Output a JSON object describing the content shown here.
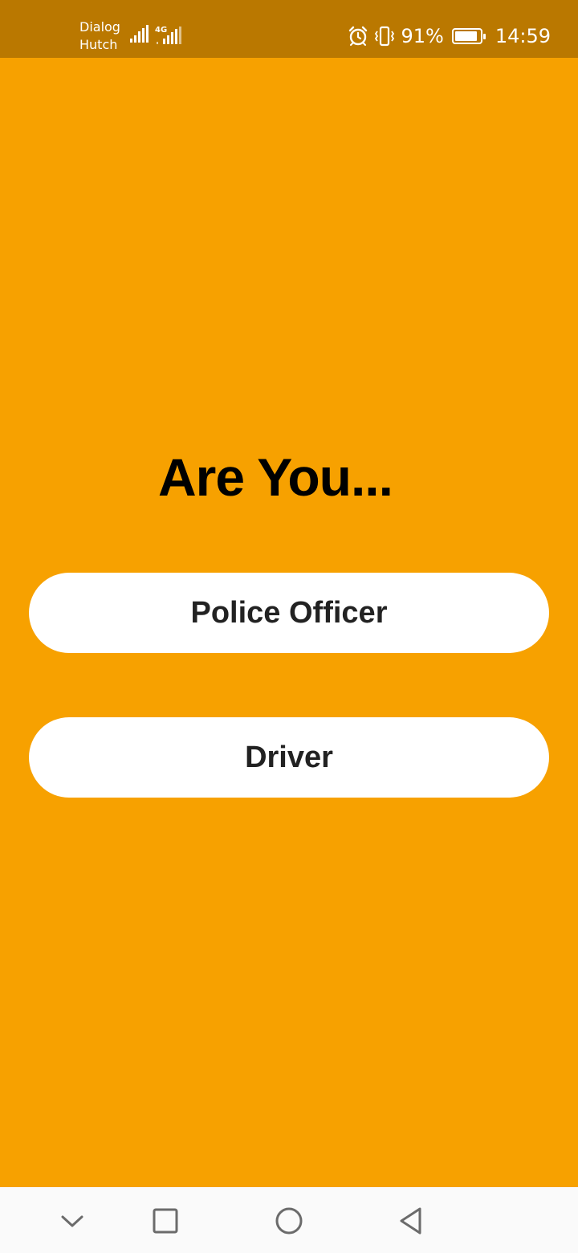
{
  "status_bar": {
    "carrier_line1": "Dialog",
    "carrier_line2": "Hutch",
    "network_type": "4G",
    "battery_percent": "91%",
    "battery_level": 0.91,
    "time": "14:59",
    "icons": [
      "signal-icon",
      "signal-4g-icon",
      "alarm-icon",
      "vibrate-icon",
      "battery-charging-icon"
    ]
  },
  "main": {
    "heading": "Are You...",
    "options": [
      {
        "label": "Police Officer"
      },
      {
        "label": "Driver"
      }
    ]
  },
  "nav_bar": {
    "buttons": [
      "hide-nav-icon",
      "recent-apps-icon",
      "home-icon",
      "back-icon"
    ]
  },
  "colors": {
    "background": "#F7A100",
    "status_bar": "#BA7800",
    "button_bg": "#FFFFFF",
    "button_text": "#222222",
    "heading_text": "#000000",
    "nav_bar_bg": "#FAFAFA",
    "nav_icon": "#6B6B6B"
  }
}
